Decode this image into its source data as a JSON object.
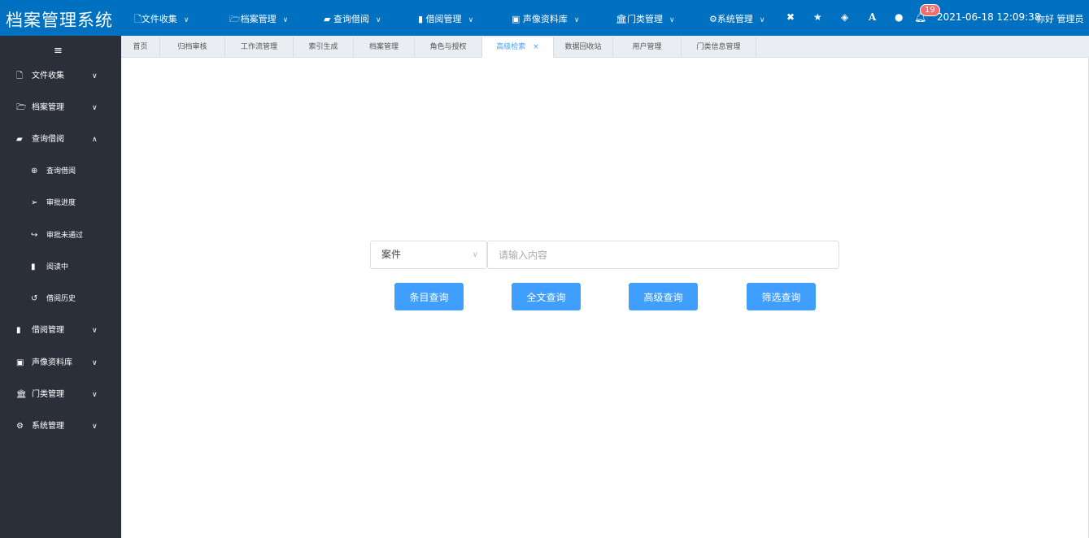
{
  "app": {
    "title": "档案管理系统",
    "datetime": "2021-06-18 12:09:38",
    "user": "你好 管理员",
    "notification_count": "19",
    "primary_color": "#0070c0",
    "accent_color": "#409eff"
  },
  "topnav": [
    {
      "label": "文件收集",
      "icon": "file-pdf-icon"
    },
    {
      "label": "档案管理",
      "icon": "folder-open-icon"
    },
    {
      "label": "查询借阅",
      "icon": "book-icon"
    },
    {
      "label": "借阅管理",
      "icon": "bookmark-icon"
    },
    {
      "label": "声像资料库",
      "icon": "file-video-icon"
    },
    {
      "label": "门类管理",
      "icon": "bank-icon"
    },
    {
      "label": "系统管理",
      "icon": "cogs-icon"
    }
  ],
  "sidebar": {
    "items": [
      {
        "label": "文件收集",
        "icon": "file-pdf-icon"
      },
      {
        "label": "档案管理",
        "icon": "folder-open-icon"
      },
      {
        "label": "查询借阅",
        "icon": "book-icon",
        "expanded": true
      },
      {
        "label": "查询借阅",
        "icon": "search-plus-icon",
        "sub": true
      },
      {
        "label": "审批进度",
        "icon": "paper-plane-icon",
        "sub": true
      },
      {
        "label": "审批未通过",
        "icon": "share-icon",
        "sub": true
      },
      {
        "label": "阅读中",
        "icon": "bookmark-icon",
        "sub": true
      },
      {
        "label": "借阅历史",
        "icon": "history-icon",
        "sub": true
      },
      {
        "label": "借阅管理",
        "icon": "bookmark-icon"
      },
      {
        "label": "声像资料库",
        "icon": "file-video-icon"
      },
      {
        "label": "门类管理",
        "icon": "bank-icon"
      },
      {
        "label": "系统管理",
        "icon": "cogs-icon"
      }
    ]
  },
  "tabs": [
    {
      "label": "首页"
    },
    {
      "label": "归档审核"
    },
    {
      "label": "工作流管理"
    },
    {
      "label": "索引生成"
    },
    {
      "label": "档案管理"
    },
    {
      "label": "角色与授权"
    },
    {
      "label": "高级检索",
      "active": true,
      "close": "×"
    },
    {
      "label": "数据回收站"
    },
    {
      "label": "用户管理"
    },
    {
      "label": "门类信息管理"
    }
  ],
  "search": {
    "type_value": "案件",
    "placeholder": "请输入内容",
    "buttons": [
      "条目查询",
      "全文查询",
      "高级查询",
      "筛选查询"
    ]
  }
}
